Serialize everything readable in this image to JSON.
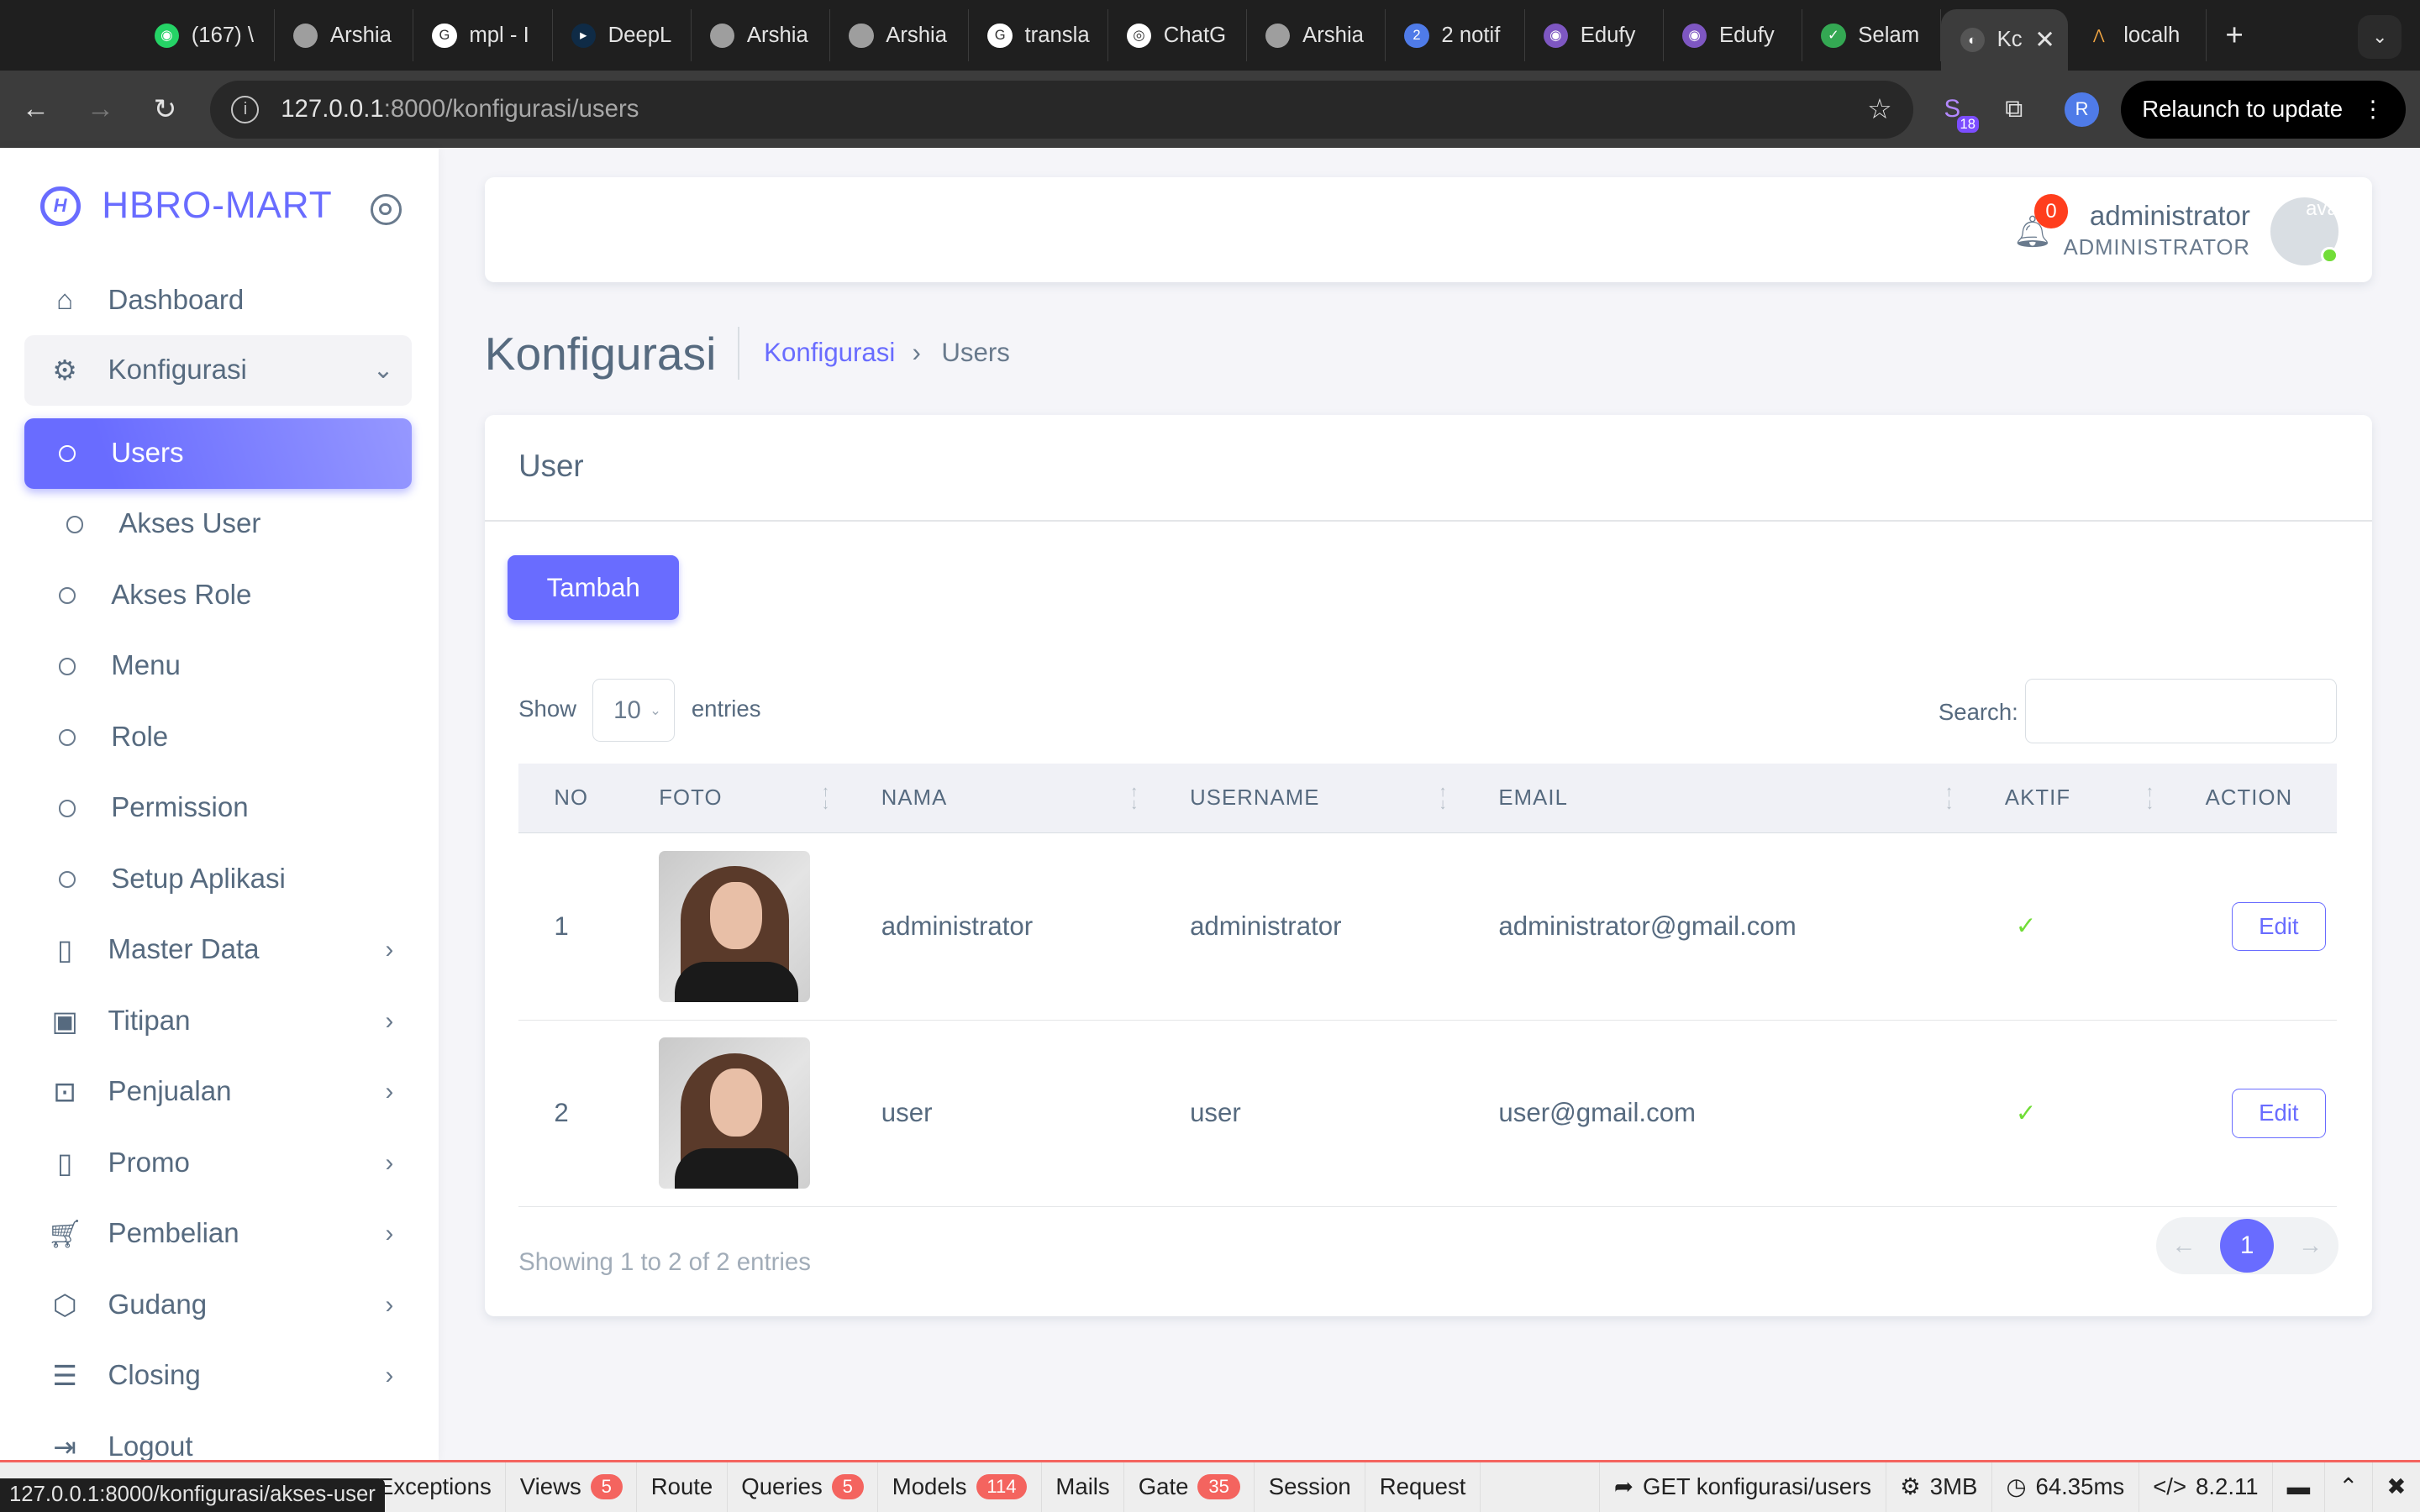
{
  "browser": {
    "tabs": [
      {
        "label": "(167) \\",
        "fav_color": "#25d366",
        "fav_text": "◉"
      },
      {
        "label": "Arshia",
        "fav_color": "#9e9e9e",
        "fav_text": ""
      },
      {
        "label": "mpl - I",
        "fav_color": "#ffffff",
        "fav_text": "G"
      },
      {
        "label": "DeepL",
        "fav_color": "#0f2b46",
        "fav_text": "▸"
      },
      {
        "label": "Arshia",
        "fav_color": "#9e9e9e",
        "fav_text": ""
      },
      {
        "label": "Arshia",
        "fav_color": "#9e9e9e",
        "fav_text": ""
      },
      {
        "label": "transla",
        "fav_color": "#ffffff",
        "fav_text": "G"
      },
      {
        "label": "ChatG",
        "fav_color": "#ffffff",
        "fav_text": "◎"
      },
      {
        "label": "Arshia",
        "fav_color": "#9e9e9e",
        "fav_text": ""
      },
      {
        "label": "2 notif",
        "fav_color": "#4f7be8",
        "fav_text": "2"
      },
      {
        "label": "Edufy",
        "fav_color": "#7e57c2",
        "fav_text": "◉"
      },
      {
        "label": "Edufy",
        "fav_color": "#7e57c2",
        "fav_text": "◉"
      },
      {
        "label": "Selam",
        "fav_color": "#34a853",
        "fav_text": "✓"
      }
    ],
    "active_tab": {
      "label": "Kc"
    },
    "last_tab": {
      "label": "localh"
    },
    "new_tab": "+",
    "url_host": "127.0.0.1",
    "url_path": ":8000/konfigurasi/users",
    "extension_badge": "18",
    "profile_initial": "R",
    "relaunch_label": "Relaunch to update",
    "status_url": "127.0.0.1:8000/konfigurasi/akses-user"
  },
  "brand": {
    "name": "HBRO-MART",
    "logo_letter": "H"
  },
  "sidebar": {
    "dashboard": "Dashboard",
    "konfigurasi": "Konfigurasi",
    "sub": [
      "Users",
      "Akses User",
      "Akses Role",
      "Menu",
      "Role",
      "Permission",
      "Setup Aplikasi"
    ],
    "groups": [
      "Master Data",
      "Titipan",
      "Penjualan",
      "Promo",
      "Pembelian",
      "Gudang",
      "Closing"
    ],
    "logout": "Logout"
  },
  "navbar": {
    "notif_count": "0",
    "user_name": "administrator",
    "user_role": "ADMINISTRATOR",
    "avatar_alt": "ava"
  },
  "page": {
    "title": "Konfigurasi",
    "breadcrumb_parent": "Konfigurasi",
    "breadcrumb_sep": "›",
    "breadcrumb_current": "Users"
  },
  "card": {
    "title": "User",
    "add_button": "Tambah",
    "show_label": "Show",
    "entries_value": "10",
    "entries_label": "entries",
    "search_label": "Search:",
    "columns": [
      "NO",
      "FOTO",
      "NAMA",
      "USERNAME",
      "EMAIL",
      "AKTIF",
      "ACTION"
    ],
    "rows": [
      {
        "no": "1",
        "nama": "administrator",
        "username": "administrator",
        "email": "administrator@gmail.com",
        "aktif": "✓",
        "action": "Edit"
      },
      {
        "no": "2",
        "nama": "user",
        "username": "user",
        "email": "user@gmail.com",
        "aktif": "✓",
        "action": "Edit"
      }
    ],
    "showing": "Showing 1 to 2 of 2 entries",
    "pager": {
      "prev": "←",
      "page": "1",
      "next": "→"
    }
  },
  "debugbar": {
    "items": [
      {
        "label": "Exceptions",
        "badge": ""
      },
      {
        "label": "Views",
        "badge": "5"
      },
      {
        "label": "Route",
        "badge": ""
      },
      {
        "label": "Queries",
        "badge": "5"
      },
      {
        "label": "Models",
        "badge": "114"
      },
      {
        "label": "Mails",
        "badge": ""
      },
      {
        "label": "Gate",
        "badge": "35"
      },
      {
        "label": "Session",
        "badge": ""
      },
      {
        "label": "Request",
        "badge": ""
      }
    ],
    "request": "GET konfigurasi/users",
    "memory": "3MB",
    "time": "64.35ms",
    "php": "8.2.11"
  },
  "colors": {
    "accent": "#696cff",
    "success": "#71dd37",
    "danger": "#ff3e1d"
  }
}
